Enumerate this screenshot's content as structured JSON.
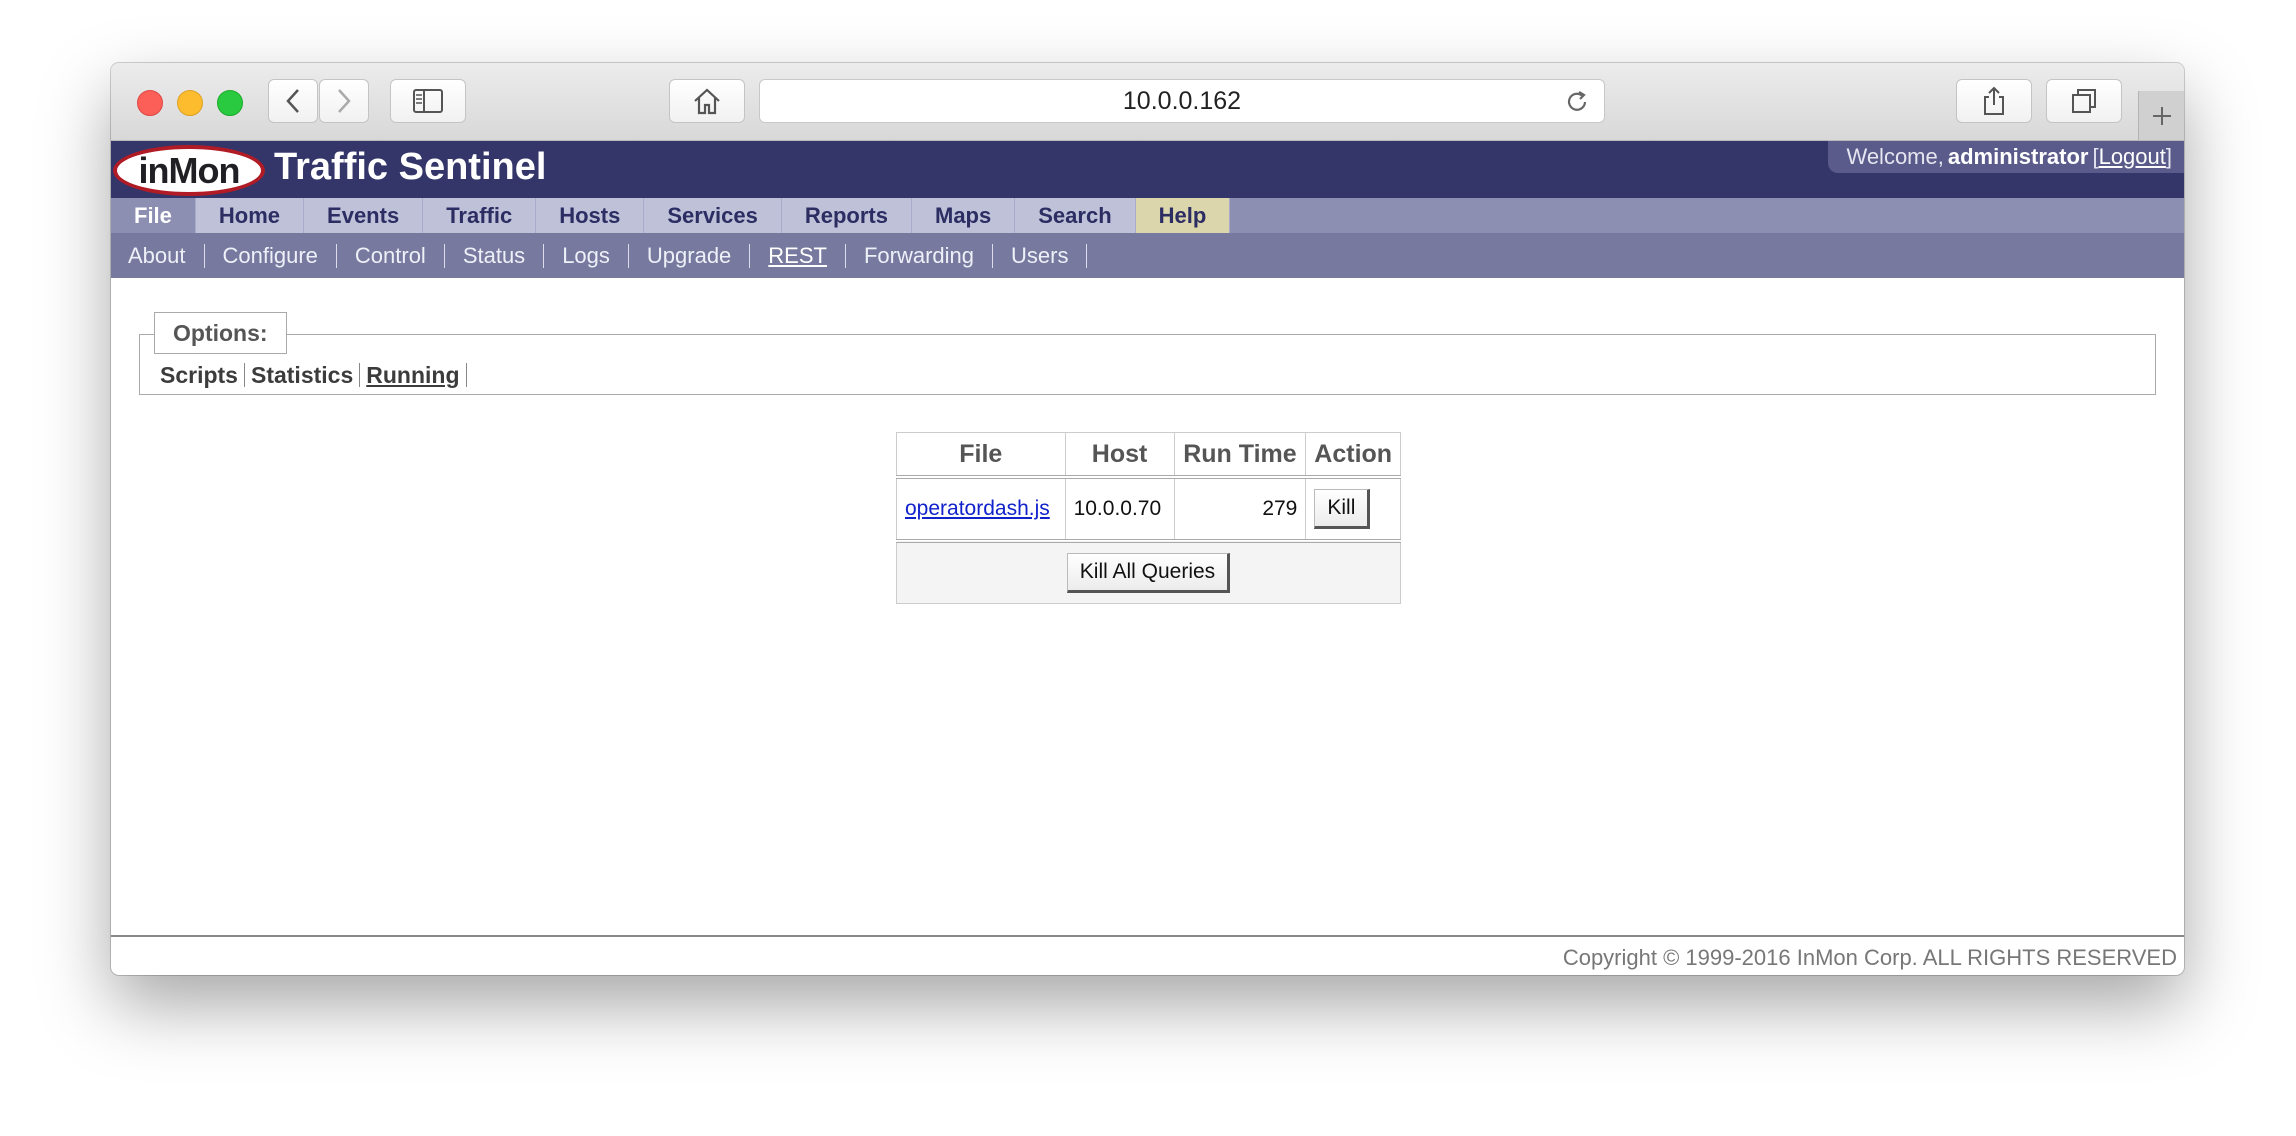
{
  "browser": {
    "url": "10.0.0.162"
  },
  "app": {
    "logo_text": "inMon",
    "title": "Traffic Sentinel",
    "welcome_prefix": "Welcome,",
    "username": "administrator",
    "logout_label": "Logout",
    "bracket_open": "[",
    "bracket_close": "]"
  },
  "nav": {
    "items": [
      {
        "label": "File",
        "active": true
      },
      {
        "label": "Home"
      },
      {
        "label": "Events"
      },
      {
        "label": "Traffic"
      },
      {
        "label": "Hosts"
      },
      {
        "label": "Services"
      },
      {
        "label": "Reports"
      },
      {
        "label": "Maps"
      },
      {
        "label": "Search"
      },
      {
        "label": "Help"
      }
    ]
  },
  "subnav": {
    "items": [
      {
        "label": "About"
      },
      {
        "label": "Configure"
      },
      {
        "label": "Control"
      },
      {
        "label": "Status"
      },
      {
        "label": "Logs"
      },
      {
        "label": "Upgrade"
      },
      {
        "label": "REST",
        "active": true
      },
      {
        "label": "Forwarding"
      },
      {
        "label": "Users"
      }
    ]
  },
  "options": {
    "legend": "Options:",
    "links": [
      {
        "label": "Scripts"
      },
      {
        "label": "Statistics"
      },
      {
        "label": "Running",
        "active": true
      }
    ]
  },
  "running": {
    "headers": [
      "File",
      "Host",
      "Run Time",
      "Action"
    ],
    "rows": [
      {
        "file": "operatordash.js",
        "host": "10.0.0.70",
        "run_time": "279",
        "action": "Kill"
      }
    ],
    "kill_all_label": "Kill All Queries"
  },
  "footer": {
    "copyright": "Copyright © 1999-2016 InMon Corp. ALL RIGHTS RESERVED"
  },
  "colors": {
    "header_bg": "#343669",
    "nav_bg": "#8d8fb2",
    "subnav_bg": "#78799f",
    "help_tab_bg": "#dcd6ac",
    "logo_ring": "#b01b26",
    "link": "#1122cc"
  }
}
